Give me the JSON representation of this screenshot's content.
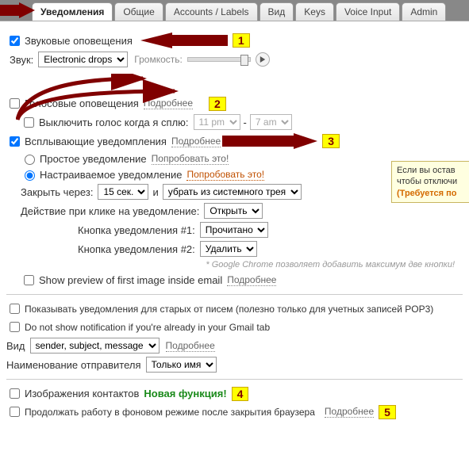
{
  "tabs": [
    "Уведомления",
    "Общие",
    "Accounts / Labels",
    "Вид",
    "Keys",
    "Voice Input",
    "Admin"
  ],
  "activeTab": 0,
  "sound": {
    "enable": "Звуковые оповещения",
    "soundLabel": "Звук:",
    "soundValue": "Electronic drops",
    "volumeLabel": "Громкость:"
  },
  "voice": {
    "enable": "Голосовые оповещения",
    "more": "Подробнее",
    "muteSleep": "Выключить голос когда я сплю:",
    "muteFrom": "11 pm",
    "muteTo": "7 am"
  },
  "popup": {
    "enable": "Всплывающие уведомпления",
    "more": "Подробнее"
  },
  "simple": {
    "label": "Простое уведомление",
    "try": "Попробовать это!"
  },
  "custom": {
    "label": "Настраиваемое уведомление",
    "try": "Попробовать это!",
    "closeAfterLabel": "Закрыть через:",
    "closeAfter": "15 сек.",
    "and": "и",
    "trayAction": "убрать из системного трея",
    "clickActionLabel": "Действие при клике на уведомление:",
    "clickAction": "Открыть",
    "btn1Label": "Кнопка уведомления #1:",
    "btn1": "Прочитано",
    "btn2Label": "Кнопка уведомления #2:",
    "btn2": "Удалить",
    "note": "* Google Chrome позволяет добавить максимум две кнопки!",
    "showPreview": "Show preview of first image inside email",
    "more": "Подробнее"
  },
  "extras": {
    "oldMail": "Показывать уведомления для старых от писем (полезно только для учетных записей POP3)",
    "noNotifIfTab": "Do not show notification if you're already in your Gmail tab",
    "viewLabel": "Вид",
    "viewValue": "sender, subject, message",
    "viewMore": "Подробнее",
    "senderNameLabel": "Наименование отправителя",
    "senderNameValue": "Только имя"
  },
  "bottom": {
    "contacts": "Изображения контактов",
    "newFeature": "Новая функция!",
    "background": "Продолжать работу в фоновом режиме после закрытия браузера",
    "more": "Подробнее"
  },
  "badges": {
    "b1": "1",
    "b2": "2",
    "b3": "3",
    "b4": "4",
    "b5": "5"
  },
  "tooltip": {
    "line1": "Если вы остав",
    "line2": "чтобы отключи",
    "line3": "(Требуется по"
  }
}
